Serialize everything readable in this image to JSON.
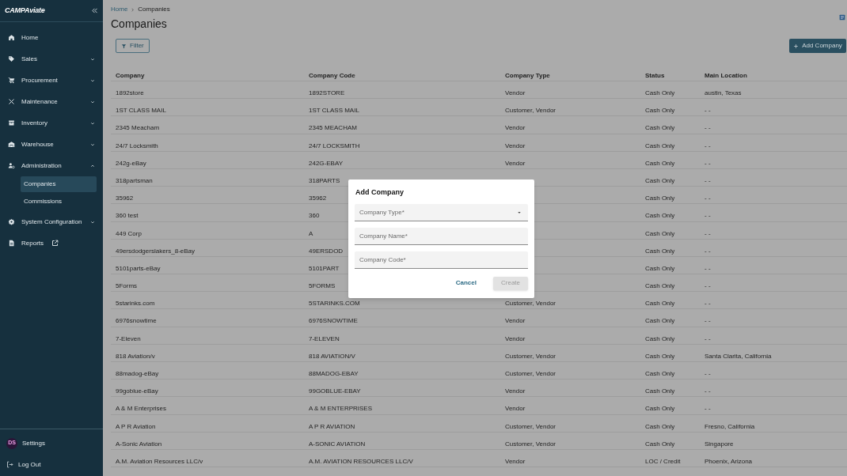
{
  "sidebar": {
    "logo": "CAMPAviate",
    "items": [
      {
        "kind": "link",
        "label": "Home"
      },
      {
        "kind": "group",
        "label": "Sales",
        "expanded": false
      },
      {
        "kind": "group",
        "label": "Procurement",
        "expanded": false
      },
      {
        "kind": "group",
        "label": "Maintenance",
        "expanded": false
      },
      {
        "kind": "group",
        "label": "Inventory",
        "expanded": false
      },
      {
        "kind": "group",
        "label": "Warehouse",
        "expanded": false
      },
      {
        "kind": "group",
        "label": "Administration",
        "expanded": true,
        "children": [
          {
            "label": "Companies",
            "selected": true
          },
          {
            "label": "Commissions",
            "selected": false
          }
        ]
      },
      {
        "kind": "group",
        "label": "System Configuration",
        "expanded": false
      },
      {
        "kind": "external",
        "label": "Reports"
      }
    ],
    "footer": [
      {
        "kind": "avatar",
        "label": "Settings",
        "initials": "DS"
      },
      {
        "kind": "logout",
        "label": "Log Out"
      }
    ]
  },
  "breadcrumb": [
    "Home",
    "Companies"
  ],
  "title": "Companies",
  "filter_button": "Filter",
  "add_button": "Add Company",
  "table": {
    "columns": [
      "Company",
      "Company Code",
      "Company Type",
      "Status",
      "Main Location"
    ],
    "rows": [
      [
        "1892store",
        "1892STORE",
        "Vendor",
        "Cash Only",
        "austin, Texas"
      ],
      [
        "1ST CLASS MAIL",
        "1ST CLASS MAIL",
        "Customer, Vendor",
        "Cash Only",
        "- -"
      ],
      [
        "2345 Meacham",
        "2345 MEACHAM",
        "Vendor",
        "Cash Only",
        "- -"
      ],
      [
        "24/7 Locksmith",
        "24/7 LOCKSMITH",
        "Vendor",
        "Cash Only",
        "- -"
      ],
      [
        "242g-eBay",
        "242G-EBAY",
        "Vendor",
        "Cash Only",
        "- -"
      ],
      [
        "318partsman",
        "318PARTS",
        null,
        "Cash Only",
        "- -"
      ],
      [
        "35962",
        "35962",
        null,
        "Cash Only",
        "- -"
      ],
      [
        "360 test",
        "360",
        null,
        "Cash Only",
        "- -"
      ],
      [
        "449 Corp",
        "A",
        null,
        "Cash Only",
        "- -"
      ],
      [
        "49ersdodgerslakers_8-eBay",
        "49ERSDOD",
        null,
        "Cash Only",
        "- -"
      ],
      [
        "5101parts-eBay",
        "5101PART",
        null,
        "Cash Only",
        "- -"
      ],
      [
        "5Forms",
        "5FORMS",
        null,
        "Cash Only",
        "- -"
      ],
      [
        "5starinks.com",
        "5STARINKS.COM",
        "Customer, Vendor",
        "Cash Only",
        "- -"
      ],
      [
        "6976snowtime",
        "6976SNOWTIME",
        "Vendor",
        "Cash Only",
        "- -"
      ],
      [
        "7-Eleven",
        "7-ELEVEN",
        "Vendor",
        "Cash Only",
        "- -"
      ],
      [
        "818 Aviation/v",
        "818 AVIATION/V",
        "Customer, Vendor",
        "Cash Only",
        "Santa Clarita, California"
      ],
      [
        "88madog-eBay",
        "88MADOG-EBAY",
        "Customer, Vendor",
        "Cash Only",
        "- -"
      ],
      [
        "99goblue-eBay",
        "99GOBLUE-EBAY",
        "Vendor",
        "Cash Only",
        "- -"
      ],
      [
        "A & M Enterprises",
        "A & M ENTERPRISES",
        "Vendor",
        "Cash Only",
        "- -"
      ],
      [
        "A P R Aviation",
        "A P R AVIATION",
        "Customer, Vendor",
        "Cash Only",
        "Fresno, California"
      ],
      [
        "A-Sonic Aviation",
        "A-SONIC AVIATION",
        "Customer, Vendor",
        "Cash Only",
        "Singapore"
      ],
      [
        "A.M. Aviation Resources LLC/v",
        "A.M. AVIATION RESOURCES LLC/V",
        "Vendor",
        "LOC / Credit",
        "Phoenix, Arizona"
      ]
    ]
  },
  "dialog": {
    "title": "Add Company",
    "fields": [
      {
        "kind": "select",
        "placeholder": "Company Type*"
      },
      {
        "kind": "text",
        "placeholder": "Company Name*"
      },
      {
        "kind": "text",
        "placeholder": "Company Code*"
      }
    ],
    "buttons": [
      {
        "label": "Cancel",
        "kind": "text",
        "disabled": false
      },
      {
        "label": "Create",
        "kind": "filled",
        "disabled": true
      }
    ]
  }
}
